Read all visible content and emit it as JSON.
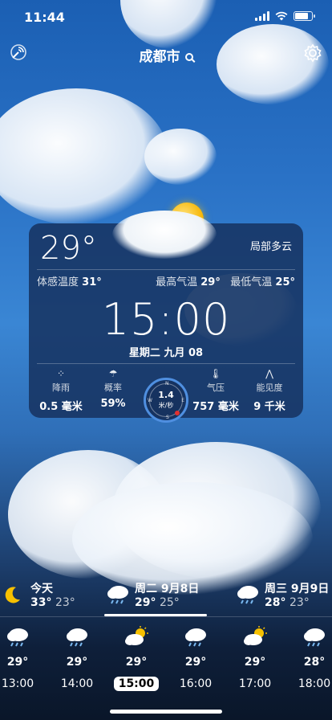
{
  "status_bar": {
    "time": "11:44"
  },
  "header": {
    "city": "成都市"
  },
  "current": {
    "temp": "29°",
    "description": "局部多云",
    "feels_like_label": "体感温度",
    "feels_like": "31°",
    "high_label": "最高气温",
    "high": "29°",
    "low_label": "最低气温",
    "low": "25°",
    "clock": "15:00",
    "date": "星期二 九月 08"
  },
  "stats": {
    "rain_label": "降雨",
    "rain_value": "0.5 毫米",
    "prob_label": "概率",
    "prob_value": "59%",
    "wind_value": "1.4",
    "wind_unit": "米/秒",
    "pressure_label": "气压",
    "pressure_value": "757 毫米",
    "visibility_label": "能见度",
    "visibility_value": "9 千米"
  },
  "compass": {
    "n": "N",
    "s": "S",
    "w": "W",
    "e": "E"
  },
  "days": [
    {
      "name": "今天",
      "high": "33°",
      "low": "23°",
      "icon": "moon-icon"
    },
    {
      "name": "周二 9月8日",
      "high": "29°",
      "low": "25°",
      "icon": "rain-cloud-icon"
    },
    {
      "name": "周三 9月9日",
      "high": "28°",
      "low": "23°",
      "icon": "rain-cloud-icon"
    }
  ],
  "hours": [
    {
      "temp": "29°",
      "time": "13:00",
      "icon": "rain-cloud-icon"
    },
    {
      "temp": "29°",
      "time": "14:00",
      "icon": "rain-cloud-icon"
    },
    {
      "temp": "29°",
      "time": "15:00",
      "icon": "sun-cloud-icon"
    },
    {
      "temp": "29°",
      "time": "16:00",
      "icon": "rain-cloud-icon"
    },
    {
      "temp": "29°",
      "time": "17:00",
      "icon": "sun-cloud-icon"
    },
    {
      "temp": "28°",
      "time": "18:00",
      "icon": "rain-cloud-icon"
    }
  ]
}
